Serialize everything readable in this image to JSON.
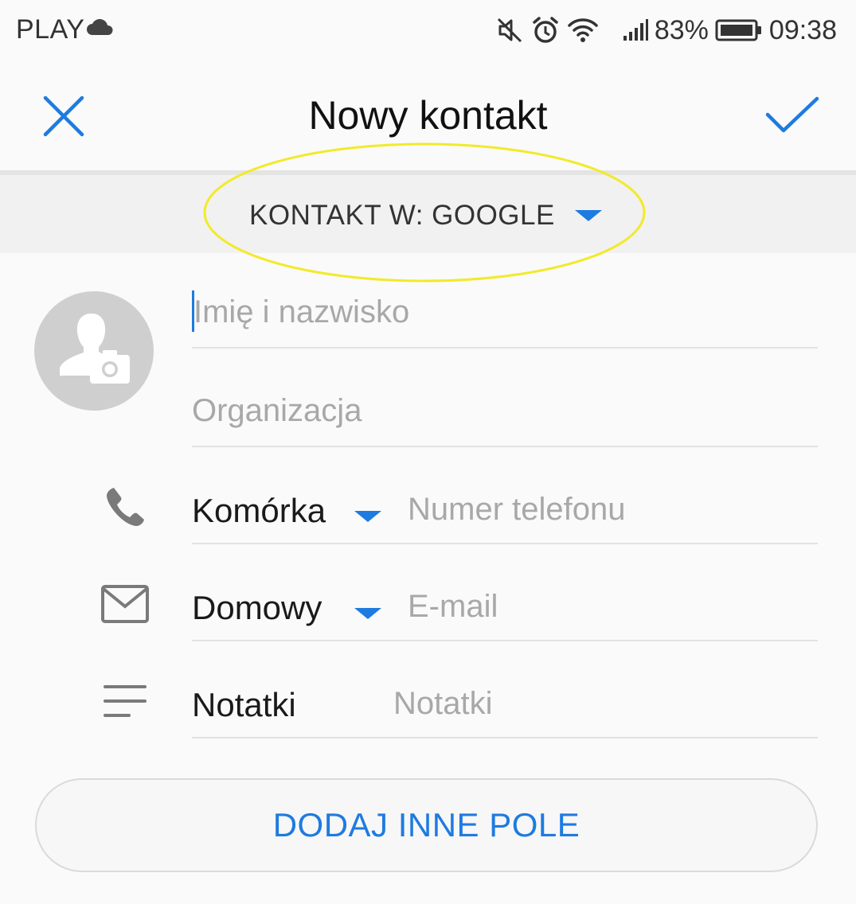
{
  "status_bar": {
    "carrier": "PLAY",
    "battery": "83%",
    "time": "09:38",
    "icons": [
      "cloud-icon",
      "mute-icon",
      "alarm-icon",
      "wifi-icon",
      "signal-icon",
      "battery-icon"
    ]
  },
  "app_bar": {
    "title": "Nowy kontakt",
    "close_icon": "close-icon",
    "confirm_icon": "check-icon"
  },
  "account": {
    "label": "KONTAKT W: GOOGLE"
  },
  "form": {
    "name_placeholder": "Imię i nazwisko",
    "organization_placeholder": "Organizacja",
    "phone": {
      "type": "Komórka",
      "placeholder": "Numer telefonu"
    },
    "email": {
      "type": "Domowy",
      "placeholder": "E-mail"
    },
    "notes": {
      "type": "Notatki",
      "placeholder": "Notatki"
    }
  },
  "add_field_button": "DODAJ INNE POLE",
  "colors": {
    "accent": "#1e7be0",
    "highlight": "#f2ea2a",
    "placeholder": "#a8a8a8",
    "icon_gray": "#7a7a7a"
  }
}
